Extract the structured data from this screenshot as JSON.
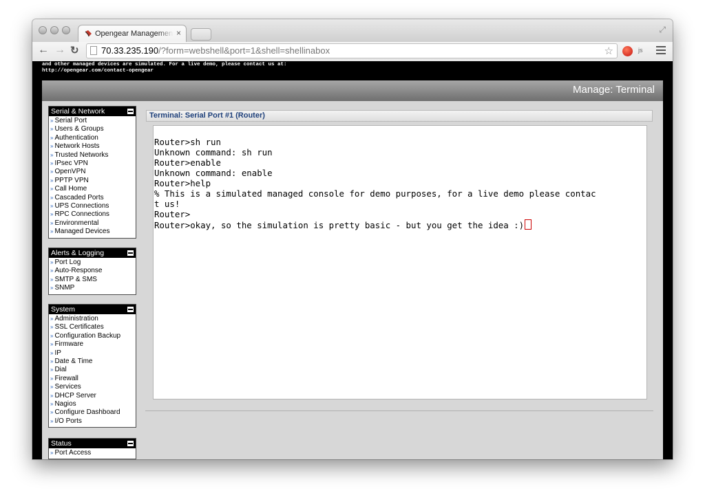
{
  "browser": {
    "tab_title": "Opengear Management Co",
    "tab_close": "×",
    "url_host": "70.33.235.190",
    "url_path": "/?form=webshell&port=1&shell=shellinabox",
    "ext_js_label": "js"
  },
  "page": {
    "notice_line1": "and other managed devices are simulated. For a live demo, please contact us at:",
    "notice_line2": "http://opengear.com/contact-opengear",
    "heading": "Manage: Terminal"
  },
  "sidebar": {
    "serial_network": {
      "title": "Serial & Network",
      "items": [
        "Serial Port",
        "Users & Groups",
        "Authentication",
        "Network Hosts",
        "Trusted Networks",
        "IPsec VPN",
        "OpenVPN",
        "PPTP VPN",
        "Call Home",
        "Cascaded Ports",
        "UPS Connections",
        "RPC Connections",
        "Environmental",
        "Managed Devices"
      ]
    },
    "alerts_logging": {
      "title": "Alerts & Logging",
      "items": [
        "Port Log",
        "Auto-Response",
        "SMTP & SMS",
        "SNMP"
      ]
    },
    "system": {
      "title": "System",
      "items": [
        "Administration",
        "SSL Certificates",
        "Configuration Backup",
        "Firmware",
        "IP",
        "Date & Time",
        "Dial",
        "Firewall",
        "Services",
        "DHCP Server",
        "Nagios",
        "Configure Dashboard",
        "I/O Ports"
      ]
    },
    "status": {
      "title": "Status",
      "items": [
        "Port Access"
      ]
    }
  },
  "terminal": {
    "title": "Terminal: Serial Port #1 (Router)",
    "lines": [
      "Router>sh run",
      "Unknown command: sh run",
      "Router>enable",
      "Unknown command: enable",
      "Router>help",
      "% This is a simulated managed console for demo purposes, for a live demo please contac",
      "t us!",
      "Router>",
      "Router>okay, so the simulation is pretty basic - but you get the idea :)"
    ]
  }
}
